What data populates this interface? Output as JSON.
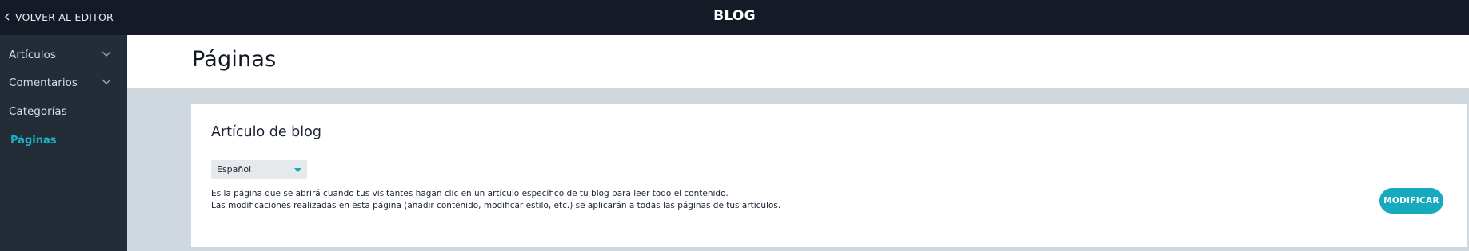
{
  "topbar": {
    "back_label": "VOLVER AL EDITOR",
    "title": "BLOG"
  },
  "sidebar": {
    "items": [
      {
        "label": "Artículos",
        "expandable": true,
        "active": false
      },
      {
        "label": "Comentarios",
        "expandable": true,
        "active": false
      },
      {
        "label": "Categorías",
        "expandable": false,
        "active": false
      },
      {
        "label": "Páginas",
        "expandable": false,
        "active": true
      }
    ]
  },
  "main": {
    "title": "Páginas",
    "card": {
      "title": "Artículo de blog",
      "language": {
        "selected": "Español"
      },
      "description_line1": "Es la página que se abrirá cuando tus visitantes hagan clic en un artículo específico de tu blog para leer todo el contenido.",
      "description_line2": "Las modificaciones realizadas en esta página (añadir contenido, modificar estilo, etc.) se aplicarán a todas las páginas de tus artículos.",
      "button_label": "MODIFICAR"
    }
  },
  "colors": {
    "topbar_bg": "#151b26",
    "sidebar_bg": "#232d37",
    "accent": "#17aabf",
    "content_bg": "#cfd7df"
  }
}
